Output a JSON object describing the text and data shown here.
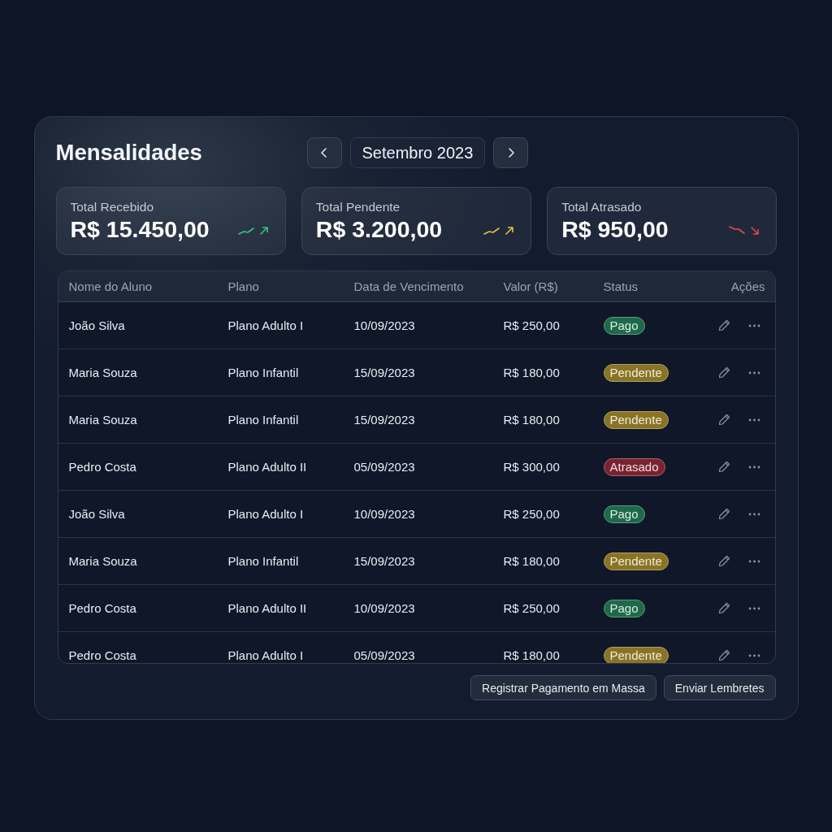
{
  "header": {
    "title": "Mensalidades",
    "month": "Setembro 2023"
  },
  "stats": [
    {
      "label": "Total Recebido",
      "value": "R$ 15.450,00",
      "kind": "rising",
      "color": "#34c77b"
    },
    {
      "label": "Total Pendente",
      "value": "R$ 3.200,00",
      "kind": "rising",
      "color": "#e8c03a"
    },
    {
      "label": "Total Atrasado",
      "value": "R$ 950,00",
      "kind": "falling",
      "color": "#e5484d"
    }
  ],
  "table": {
    "columns": [
      "Nome do Aluno",
      "Plano",
      "Data de Vencimento",
      "Valor (R$)",
      "Status",
      "Ações"
    ],
    "rows": [
      {
        "name": "João Silva",
        "plan": "Plano Adulto I",
        "due_date": "10/09/2023",
        "amount": "R$ 250,00",
        "status": {
          "label": "Pago",
          "color": "#1d6a48"
        }
      },
      {
        "name": "Maria Souza",
        "plan": "Plano Infantil",
        "due_date": "15/09/2023",
        "amount": "R$ 180,00",
        "status": {
          "label": "Pendente",
          "color": "#8a7424"
        }
      },
      {
        "name": "Maria Souza",
        "plan": "Plano Infantil",
        "due_date": "15/09/2023",
        "amount": "R$ 180,00",
        "status": {
          "label": "Pendente",
          "color": "#8a7424"
        }
      },
      {
        "name": "Pedro Costa",
        "plan": "Plano Adulto II",
        "due_date": "05/09/2023",
        "amount": "R$ 300,00",
        "status": {
          "label": "Atrasado",
          "color": "#7a2330"
        }
      },
      {
        "name": "João Silva",
        "plan": "Plano Adulto I",
        "due_date": "10/09/2023",
        "amount": "R$ 250,00",
        "status": {
          "label": "Pago",
          "color": "#1d6a48"
        }
      },
      {
        "name": "Maria Souza",
        "plan": "Plano Infantil",
        "due_date": "15/09/2023",
        "amount": "R$ 180,00",
        "status": {
          "label": "Pendente",
          "color": "#8a7424"
        }
      },
      {
        "name": "Pedro Costa",
        "plan": "Plano Adulto II",
        "due_date": "10/09/2023",
        "amount": "R$ 250,00",
        "status": {
          "label": "Pago",
          "color": "#1d6a48"
        }
      },
      {
        "name": "Pedro Costa",
        "plan": "Plano Adulto I",
        "due_date": "05/09/2023",
        "amount": "R$ 180,00",
        "status": {
          "label": "Pendente",
          "color": "#8a7424"
        }
      }
    ]
  },
  "actions": [
    "Registrar Pagamento em Massa",
    "Enviar Lembretes"
  ]
}
